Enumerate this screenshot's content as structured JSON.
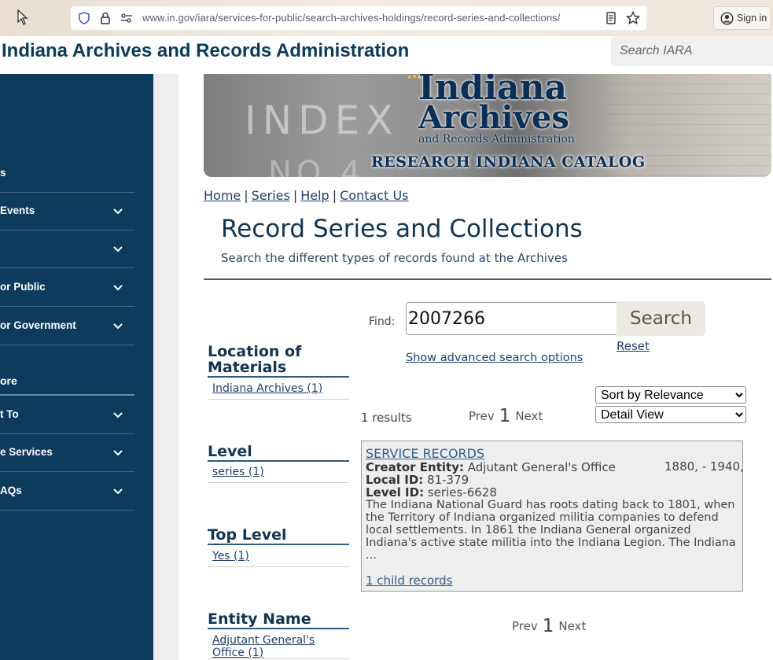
{
  "browser": {
    "url": "www.in.gov/iara/services-for-public/search-archives-holdings/record-series-and-collections/",
    "sign_in": "Sign in"
  },
  "site": {
    "title": "Indiana Archives and Records Administration",
    "search_placeholder": "Search IARA"
  },
  "left_nav": {
    "items": [
      {
        "label": "s",
        "chevron": false
      },
      {
        "label": "Events",
        "chevron": true
      },
      {
        "label": "",
        "chevron": true
      },
      {
        "label": "or Public",
        "chevron": true
      },
      {
        "label": "or Government",
        "chevron": true
      }
    ],
    "section": "ore",
    "items2": [
      {
        "label": "t To",
        "chevron": true
      },
      {
        "label": "e Services",
        "chevron": true
      },
      {
        "label": "AQs",
        "chevron": true
      }
    ]
  },
  "banner": {
    "bg_text1": "INDEX",
    "bg_text2": "NO 4",
    "brand_line1": "Indiana",
    "brand_line2": "Archives",
    "brand_line3": "and Records Administration",
    "catalog": "RESEARCH INDIANA CATALOG"
  },
  "links": {
    "home": "Home",
    "series": "Series",
    "help": "Help",
    "contact": "Contact Us",
    "separator": "|"
  },
  "page": {
    "title": "Record Series and Collections",
    "subtitle": "Search the different types of records found at the Archives"
  },
  "search": {
    "find_label": "Find:",
    "value": "2007266",
    "button": "Search",
    "reset": "Reset",
    "advanced": "Show advanced search options"
  },
  "facets": {
    "location": {
      "heading": "Location of Materials",
      "item": "Indiana Archives (1)"
    },
    "level": {
      "heading": "Level",
      "item": "series (1)"
    },
    "top_level": {
      "heading": "Top Level",
      "item": "Yes (1)"
    },
    "entity": {
      "heading": "Entity Name",
      "item": "Adjutant General's Office (1)"
    }
  },
  "results": {
    "count": "1 results",
    "prev": "Prev",
    "page": "1",
    "next": "Next",
    "sort_options": [
      "Sort by Relevance"
    ],
    "view_options": [
      "Detail View"
    ]
  },
  "record": {
    "title": "SERVICE RECORDS",
    "dates": "1880, - 1940,",
    "creator_label": "Creator Entity:",
    "creator": "Adjutant General's Office",
    "local_label": "Local ID:",
    "local": "81-379",
    "level_label": "Level ID:",
    "level": "series-6628",
    "description": "The Indiana National Guard has roots dating back to 1801, when the Territory of Indiana organized militia companies to defend local settlements. In 1861 the Indiana General organized Indiana's active state militia into the Indiana Legion. The Indiana ...",
    "child": "1 child records"
  },
  "colors": {
    "brand_navy": "#0d3b5c",
    "title_navy": "#0b3b5c",
    "link_blue": "#1f3f6b",
    "card_bg": "#eeeeee"
  }
}
